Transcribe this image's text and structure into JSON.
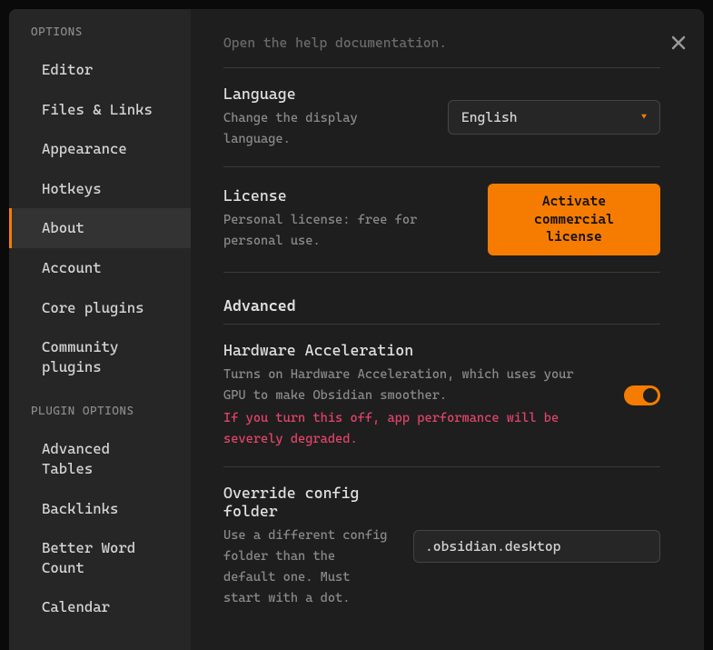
{
  "sidebar": {
    "options_header": "OPTIONS",
    "plugin_options_header": "PLUGIN OPTIONS",
    "items": [
      {
        "label": "Editor"
      },
      {
        "label": "Files & Links"
      },
      {
        "label": "Appearance"
      },
      {
        "label": "Hotkeys"
      },
      {
        "label": "About"
      },
      {
        "label": "Account"
      },
      {
        "label": "Core plugins"
      },
      {
        "label": "Community plugins"
      }
    ],
    "plugin_items": [
      {
        "label": "Advanced Tables"
      },
      {
        "label": "Backlinks"
      },
      {
        "label": "Better Word Count"
      },
      {
        "label": "Calendar"
      }
    ]
  },
  "content": {
    "help_desc_partial": "Open the help documentation.",
    "language": {
      "title": "Language",
      "desc": "Change the display language.",
      "value": "English"
    },
    "license": {
      "title": "License",
      "desc": "Personal license: free for personal use.",
      "button": "Activate commercial license"
    },
    "advanced_heading": "Advanced",
    "hw_accel": {
      "title": "Hardware Acceleration",
      "desc": "Turns on Hardware Acceleration, which uses your GPU to make Obsidian smoother.",
      "warning": "If you turn this off, app performance will be severely degraded.",
      "enabled": true
    },
    "override_config": {
      "title": "Override config folder",
      "desc": "Use a different config folder than the default one. Must start with a dot.",
      "value": ".obsidian.desktop"
    }
  }
}
